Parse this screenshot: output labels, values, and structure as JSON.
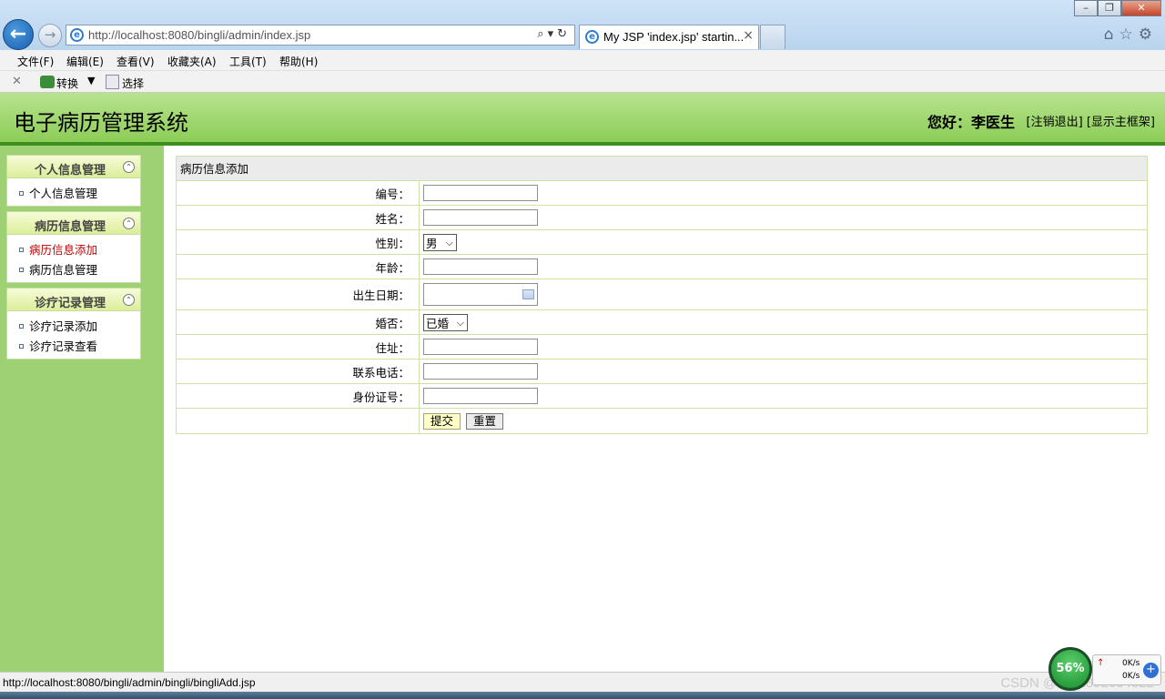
{
  "browser": {
    "address": "http://localhost:8080/bingli/admin/index.jsp",
    "tab_title": "My JSP 'index.jsp' startin...",
    "menu": [
      "文件(F)",
      "编辑(E)",
      "查看(V)",
      "收藏夹(A)",
      "工具(T)",
      "帮助(H)"
    ],
    "cmd_convert": "转换",
    "cmd_select": "选择",
    "status_url": "http://localhost:8080/bingli/admin/bingli/bingliAdd.jsp"
  },
  "header": {
    "title": "电子病历管理系统",
    "greeting": "您好：李医生",
    "logout": "[注销退出]",
    "show_frame": "[显示主框架]"
  },
  "sidebar": {
    "panels": [
      {
        "title": "个人信息管理",
        "items": [
          "个人信息管理"
        ]
      },
      {
        "title": "病历信息管理",
        "items": [
          "病历信息添加",
          "病历信息管理"
        ]
      },
      {
        "title": "诊疗记录管理",
        "items": [
          "诊疗记录添加",
          "诊疗记录查看"
        ]
      }
    ]
  },
  "form": {
    "caption": "病历信息添加",
    "labels": {
      "id": "编号：",
      "name": "姓名：",
      "gender": "性别：",
      "age": "年龄：",
      "birth": "出生日期：",
      "married": "婚否：",
      "address": "住址：",
      "phone": "联系电话：",
      "idcard": "身份证号："
    },
    "gender_value": "男",
    "married_value": "已婚",
    "submit": "提交",
    "reset": "重置"
  },
  "widget": {
    "percent": "56%",
    "up": "0K/s",
    "down": "0K/s"
  },
  "watermark": "CSDN @QQ2892034822"
}
